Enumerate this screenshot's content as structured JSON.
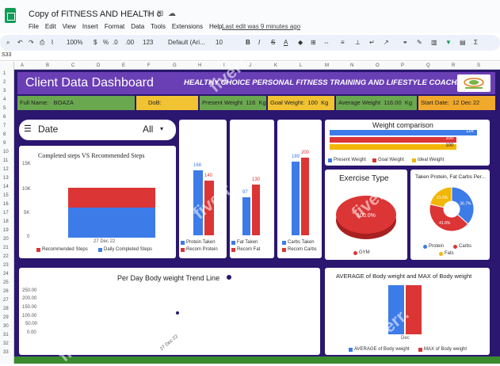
{
  "window": {
    "doc_title": "Copy of FITNESS AND HEALTH c",
    "last_edit": "Last edit was 9 minutes ago",
    "menu": [
      "File",
      "Edit",
      "View",
      "Insert",
      "Format",
      "Data",
      "Tools",
      "Extensions",
      "Help"
    ]
  },
  "toolbar": {
    "zoom": "100%",
    "currency": "$",
    "percent": "%",
    "decimals": ".0",
    "dec_more": ".00",
    "format": "123",
    "font": "Default (Ari...",
    "font_size": "10",
    "bold": "B",
    "italic": "I",
    "strike": "S",
    "text_color": "A"
  },
  "formula_bar": {
    "cell_ref": "S33"
  },
  "columns": [
    "A",
    "B",
    "C",
    "D",
    "E",
    "F",
    "G",
    "H",
    "I",
    "J",
    "K",
    "L",
    "M",
    "N",
    "O",
    "P",
    "Q",
    "R",
    "S"
  ],
  "rows": [
    "1",
    "2",
    "3",
    "4",
    "5",
    "6",
    "7",
    "8",
    "9",
    "10",
    "11",
    "12",
    "13",
    "14",
    "15",
    "16",
    "17",
    "18",
    "19",
    "20",
    "21",
    "22",
    "23",
    "24",
    "25",
    "26",
    "27",
    "28",
    "29",
    "30",
    "31",
    "32",
    "33"
  ],
  "dashboard": {
    "title": "Client Data Dashboard",
    "subtitle": "HEALTHY CHOICE PERSONAL FITNESS TRAINING AND LIFESTYLE COACHING",
    "info": {
      "full_name_label": "Full Name:",
      "full_name": "BOAZA",
      "dob_label": "DoB:",
      "present_weight_label": "Present Weight",
      "present_weight": "116",
      "present_unit": "Kg",
      "goal_weight_label": "Goal Weight:",
      "goal_weight": "100",
      "goal_unit": "Kg",
      "avg_weight_label": "Average Weight",
      "avg_weight": "116.00",
      "avg_unit": "Kg",
      "start_date_label": "Start Date:",
      "start_date": "12 Dec 22"
    },
    "date_filter": {
      "label": "Date",
      "value": "All"
    },
    "colors": {
      "blue": "#3d7be8",
      "red": "#dc3535",
      "yellow": "#f2b705",
      "purple": "#2b1670",
      "band": "#6a3fb5",
      "green": "#6aa84f",
      "orange": "#f1a92b"
    }
  },
  "chart_data": [
    {
      "type": "bar",
      "title": "Completed steps VS Recommended Steps",
      "categories": [
        "27 Dec 22"
      ],
      "series": [
        {
          "name": "Recommended Steps",
          "values": [
            10000
          ]
        },
        {
          "name": "Daily Completed Steps",
          "values": [
            6000
          ]
        }
      ],
      "stacked": true,
      "yticks": [
        "15K",
        "10K",
        "5K",
        "0"
      ],
      "ylim": [
        0,
        15000
      ]
    },
    {
      "type": "bar",
      "title": "",
      "series": [
        {
          "name": "Protein Taken",
          "values": [
            168
          ]
        },
        {
          "name": "Recom Protein",
          "values": [
            140
          ]
        }
      ]
    },
    {
      "type": "bar",
      "title": "",
      "series": [
        {
          "name": "Fat Taken",
          "values": [
            97
          ]
        },
        {
          "name": "Recom Fat",
          "values": [
            130
          ]
        }
      ]
    },
    {
      "type": "bar",
      "title": "",
      "series": [
        {
          "name": "Carbs Taken",
          "values": [
            189
          ]
        },
        {
          "name": "Recom Carbs",
          "values": [
            200
          ]
        }
      ]
    },
    {
      "type": "bar",
      "title": "Weight comparison",
      "orientation": "horizontal",
      "series": [
        {
          "name": "Present Weight",
          "values": [
            116
          ]
        },
        {
          "name": "Goal Weight",
          "values": [
            100
          ]
        },
        {
          "name": "Ideal Weight",
          "values": [
            100
          ]
        }
      ]
    },
    {
      "type": "pie",
      "title": "Exercise Type",
      "slices": [
        {
          "name": "GYM",
          "value": 100.0,
          "label": "100.0%"
        }
      ]
    },
    {
      "type": "pie",
      "title": "Taken Protein, Fat Carbs Per...",
      "slices": [
        {
          "name": "Protein",
          "value": 36.7,
          "label": "36.7%"
        },
        {
          "name": "Carbs",
          "value": 41.8,
          "label": "41.8%"
        },
        {
          "name": "Fats",
          "value": 21.5,
          "label": "21.5%"
        }
      ]
    },
    {
      "type": "scatter",
      "title": "Per Day Body weight Trend Line",
      "x": [
        "27 Dec 22"
      ],
      "y": [
        116
      ],
      "yticks": [
        "250.00",
        "200.00",
        "150.00",
        "100.00",
        "50.00",
        "0.00"
      ],
      "ylim": [
        0,
        250
      ]
    },
    {
      "type": "bar",
      "title": "AVERAGE of Body weight and MAX of Body weight",
      "categories": [
        "Dec"
      ],
      "series": [
        {
          "name": "AVERAGE of Body weight",
          "values": [
            116
          ]
        },
        {
          "name": "MAX of Body weight",
          "values": [
            116
          ]
        }
      ]
    }
  ]
}
